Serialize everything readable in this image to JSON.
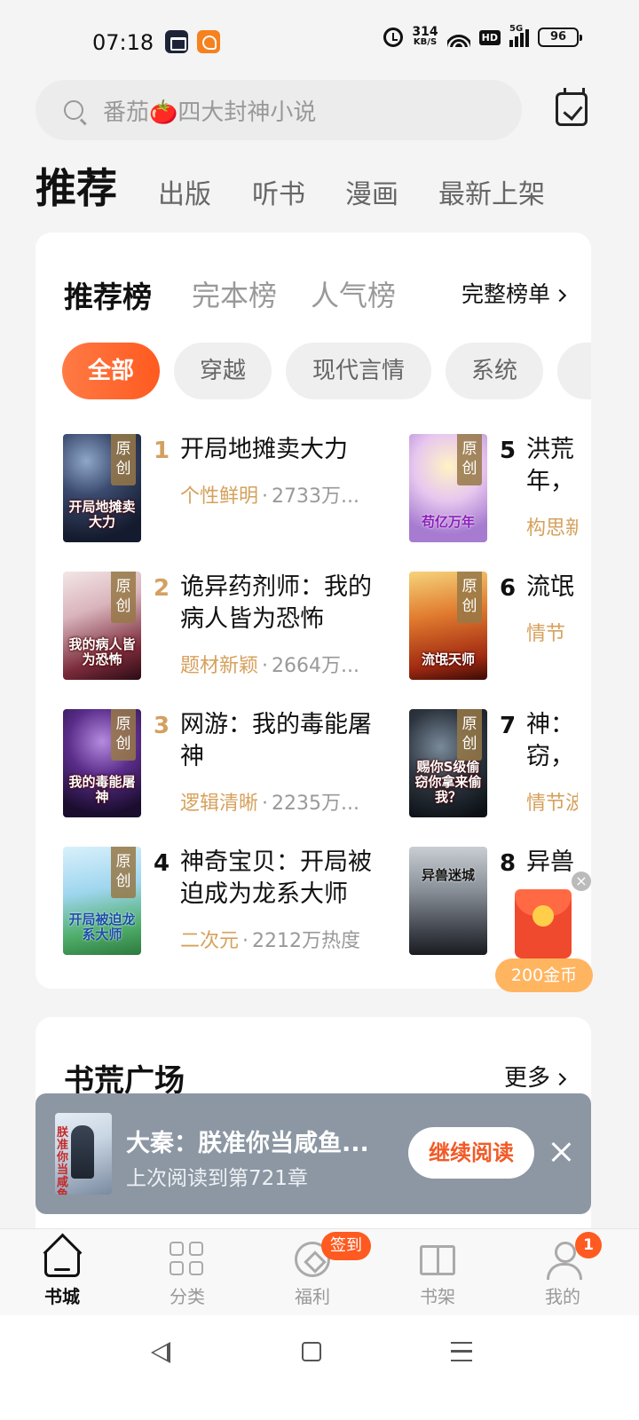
{
  "status_bar": {
    "time": "07:18",
    "net_speed_value": "314",
    "net_speed_unit": "KB/S",
    "hd": "HD",
    "network": "5G",
    "battery": "96"
  },
  "search": {
    "placeholder": "番茄🍅四大封神小说"
  },
  "top_tabs": [
    "推荐",
    "出版",
    "听书",
    "漫画",
    "最新上架"
  ],
  "ranking": {
    "tabs": [
      "推荐榜",
      "完本榜",
      "人气榜"
    ],
    "full_list": "完整榜单",
    "chips": [
      "全部",
      "穿越",
      "现代言情",
      "系统",
      ""
    ],
    "badge": "原创",
    "books": [
      {
        "rank": "1",
        "title": "开局地摊卖大力",
        "tag": "个性鲜明",
        "heat": "2733万...",
        "cover_text": "开局地摊卖大力",
        "original": true
      },
      {
        "rank": "2",
        "title": "诡异药剂师：我的病人皆为恐怖",
        "tag": "题材新颖",
        "heat": "2664万...",
        "cover_text": "我的病人皆为恐怖",
        "original": true
      },
      {
        "rank": "3",
        "title": "网游：我的毒能屠神",
        "tag": "逻辑清晰",
        "heat": "2235万...",
        "cover_text": "我的毒能屠神",
        "original": true
      },
      {
        "rank": "4",
        "title": "神奇宝贝：开局被迫成为龙系大师",
        "tag": "二次元",
        "heat": "2212万热度",
        "cover_text": "开局被迫龙系大师",
        "original": true
      },
      {
        "rank": "5",
        "title": "洪荒",
        "title2": "年，",
        "tag": "构思新",
        "heat": "",
        "cover_text": "苟亿万年",
        "original": true
      },
      {
        "rank": "6",
        "title": "流氓",
        "title2": "",
        "tag": "情节",
        "heat": "",
        "cover_text": "流氓天师",
        "original": true
      },
      {
        "rank": "7",
        "title": "神：",
        "title2": "窃，",
        "tag": "情节波",
        "heat": "",
        "cover_text": "赐你S级偷窃你拿来偷我？",
        "original": true
      },
      {
        "rank": "8",
        "title": "异兽",
        "title2": "",
        "tag": "",
        "heat": "",
        "cover_text": "异兽迷城",
        "original": false
      }
    ]
  },
  "red_packet": {
    "coins": "200金币",
    "close": "×"
  },
  "plaza": {
    "title": "书荒广场",
    "more": "更多"
  },
  "continue_reading": {
    "title": "大秦：朕准你当咸鱼...",
    "progress": "上次阅读到第721章",
    "button": "继续阅读",
    "cover_text": "朕准你当咸鱼"
  },
  "bottom_nav": {
    "items": [
      "书城",
      "分类",
      "福利",
      "书架",
      "我的"
    ],
    "sign_badge": "签到",
    "notif_count": "1"
  },
  "colors": {
    "accent": "#ff5a1f",
    "gold": "#d4a060",
    "tag": "#d6a15c",
    "continue_bg": "#8c97a3"
  }
}
